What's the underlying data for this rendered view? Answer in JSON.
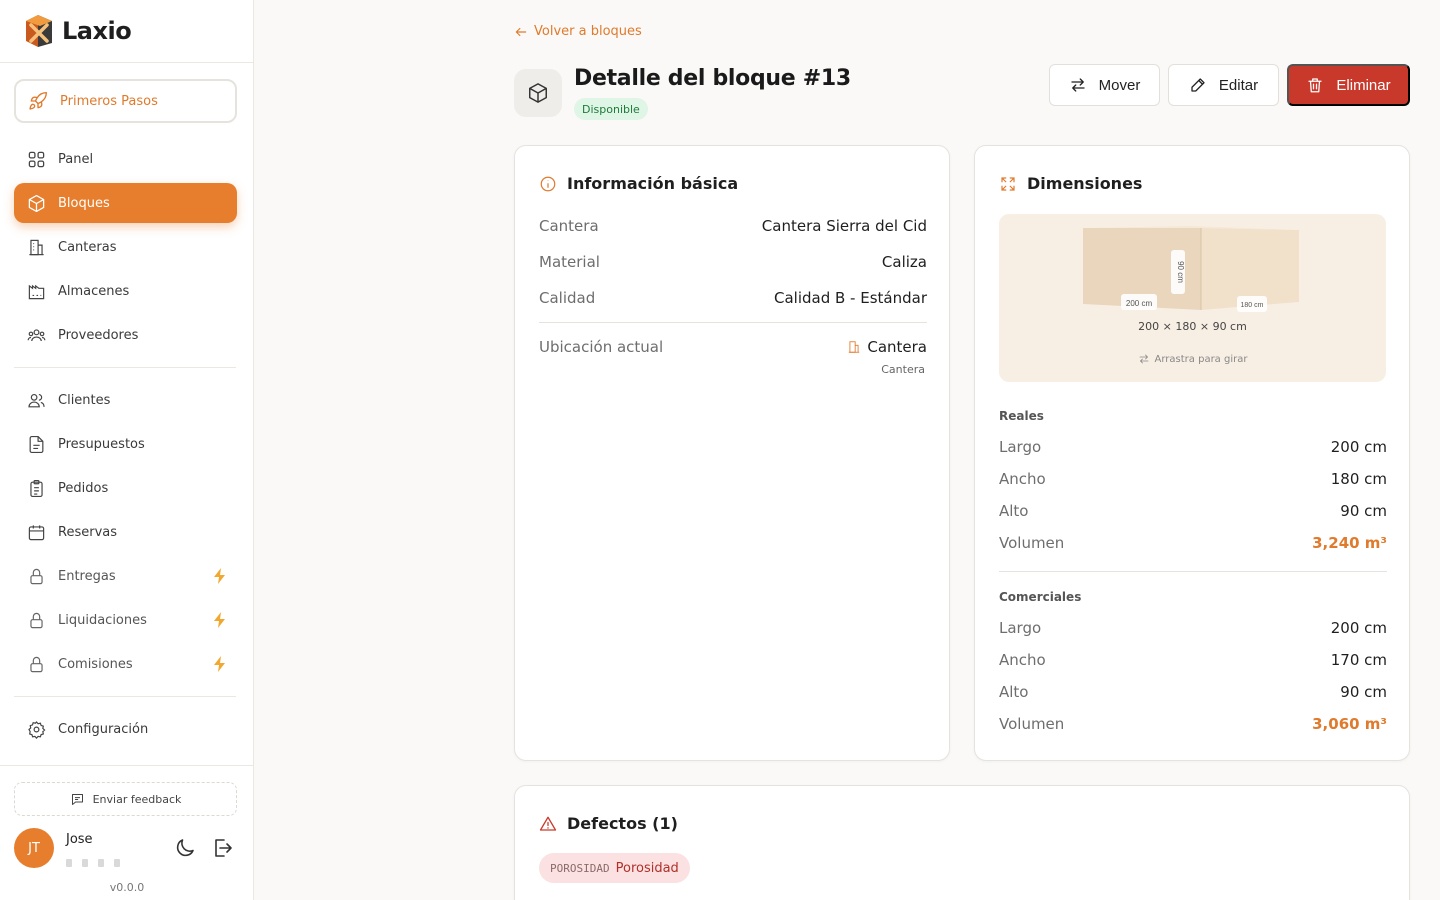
{
  "app": {
    "name": "Laxio",
    "version": "v0.0.0"
  },
  "sidebar": {
    "first_steps": "Primeros Pasos",
    "items": [
      {
        "label": "Panel",
        "icon": "grid-icon"
      },
      {
        "label": "Bloques",
        "icon": "cube-icon",
        "active": true
      },
      {
        "label": "Canteras",
        "icon": "building-icon"
      },
      {
        "label": "Almacenes",
        "icon": "warehouse-icon"
      },
      {
        "label": "Proveedores",
        "icon": "users-group-icon"
      },
      {
        "label": "Clientes",
        "icon": "users-icon"
      },
      {
        "label": "Presupuestos",
        "icon": "file-icon"
      },
      {
        "label": "Pedidos",
        "icon": "clipboard-icon"
      },
      {
        "label": "Reservas",
        "icon": "calendar-icon"
      },
      {
        "label": "Entregas",
        "icon": "lock-icon",
        "badge": "bolt-icon"
      },
      {
        "label": "Liquidaciones",
        "icon": "lock-icon",
        "badge": "bolt-icon"
      },
      {
        "label": "Comisiones",
        "icon": "lock-icon",
        "badge": "bolt-icon"
      },
      {
        "label": "Configuración",
        "icon": "gear-icon"
      }
    ],
    "feedback": "Enviar feedback",
    "user": {
      "initials": "JT",
      "name": "Jose"
    }
  },
  "header": {
    "back_label": "Volver a bloques",
    "title": "Detalle del bloque #13",
    "status": "Disponible",
    "actions": {
      "move": "Mover",
      "edit": "Editar",
      "delete": "Eliminar"
    }
  },
  "basic_info": {
    "title": "Información básica",
    "rows": [
      {
        "label": "Cantera",
        "value": "Cantera Sierra del Cid"
      },
      {
        "label": "Material",
        "value": "Caliza"
      },
      {
        "label": "Calidad",
        "value": "Calidad B - Estándar"
      }
    ],
    "location": {
      "label": "Ubicación actual",
      "value": "Cantera",
      "sub": "Cantera"
    }
  },
  "dimensions": {
    "title": "Dimensiones",
    "preview": {
      "front_label": "200 cm",
      "side_label": "180 cm",
      "height_label": "90 cm",
      "caption": "200 × 180 × 90 cm",
      "hint": "Arrastra para girar"
    },
    "real": {
      "label": "Reales",
      "rows": [
        {
          "label": "Largo",
          "value": "200 cm"
        },
        {
          "label": "Ancho",
          "value": "180 cm"
        },
        {
          "label": "Alto",
          "value": "90 cm"
        },
        {
          "label": "Volumen",
          "value": "3,240 m³"
        }
      ]
    },
    "commercial": {
      "label": "Comerciales",
      "rows": [
        {
          "label": "Largo",
          "value": "200 cm"
        },
        {
          "label": "Ancho",
          "value": "170 cm"
        },
        {
          "label": "Alto",
          "value": "90 cm"
        },
        {
          "label": "Volumen",
          "value": "3,060 m³"
        }
      ]
    }
  },
  "defects": {
    "title": "Defectos (1)",
    "items": [
      {
        "code": "POROSIDAD",
        "name": "Porosidad"
      }
    ]
  },
  "colors": {
    "accent": "#e67e2e",
    "danger": "#c9392b",
    "success_bg": "#dff5e6"
  }
}
